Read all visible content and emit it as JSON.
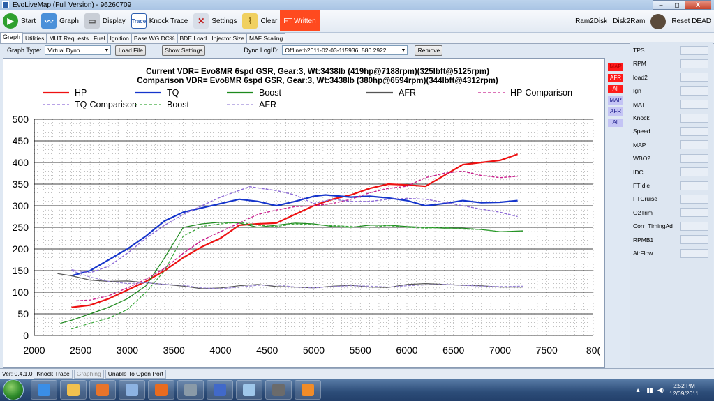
{
  "window": {
    "title": "EvoLiveMap (Full Version) - 96260709",
    "controls": [
      "–",
      "◻",
      "X"
    ]
  },
  "toolbar": {
    "start": "Start",
    "graph": "Graph",
    "display": "Display",
    "knock_trace": "Knock Trace",
    "settings": "Settings",
    "clear": "Clear",
    "ft_written": "FT Written",
    "ram2disk": "Ram2Disk",
    "disk2ram": "Disk2Ram",
    "reset_dead": "Reset DEAD"
  },
  "tabs": [
    "Graph",
    "Utilities",
    "MUT Requests",
    "Fuel",
    "Ignition",
    "Base WG DC%",
    "BDE Load",
    "Injector Size",
    "MAF Scaling"
  ],
  "options": {
    "graph_type_label": "Graph Type:",
    "graph_type_value": "Virtual Dyno",
    "load_file": "Load File",
    "show_settings": "Show Settings",
    "dyno_log_label": "Dyno LogID:",
    "dyno_log_value": "Offline:b2011-02-03-115936: 580.2922",
    "remove": "Remove"
  },
  "side_tags": [
    {
      "label": "MAP",
      "color": "#ff1a1a",
      "text": "#b00000"
    },
    {
      "label": "AFR",
      "color": "#ff1a1a",
      "text": "#ffffff"
    },
    {
      "label": "All",
      "color": "#ff1a1a",
      "text": "#ffffff"
    },
    {
      "label": "MAP",
      "color": "#c4c4f5",
      "text": "#1a1a8a"
    },
    {
      "label": "AFR",
      "color": "#c4c4f5",
      "text": "#1a1a8a"
    },
    {
      "label": "All",
      "color": "#c4c4f5",
      "text": "#1a1a8a"
    }
  ],
  "sensors": [
    "TPS",
    "RPM",
    "load2",
    "Ign",
    "MAT",
    "Knock",
    "Speed",
    "MAP",
    "WBO2",
    "IDC",
    "FTIdle",
    "FTCruise",
    "O2Trim",
    "Corr_TimingAd",
    "RPMB1",
    "AirFlow"
  ],
  "status": {
    "version": "Ver: 0.4.1.0",
    "knock_trace": "Knock Trace",
    "graphing": "Graphing",
    "port": "Unable To Open Port"
  },
  "clock": {
    "time": "2:52 PM",
    "date": "12/09/2011"
  },
  "taskbar_apps": [
    {
      "icon": "ie-icon",
      "color": "#3a8ee6"
    },
    {
      "icon": "folder-icon",
      "color": "#f2c14e"
    },
    {
      "icon": "media-player-icon",
      "color": "#e8742a"
    },
    {
      "icon": "paint-icon",
      "color": "#8db3e2"
    },
    {
      "icon": "firefox-icon",
      "color": "#e86b1f"
    },
    {
      "icon": "chip-icon",
      "color": "#8a9aa8"
    },
    {
      "icon": "vb-icon",
      "color": "#4169c9"
    },
    {
      "icon": "disc-icon",
      "color": "#9fc7ea"
    },
    {
      "icon": "car-icon",
      "color": "#6b6b6b"
    },
    {
      "icon": "tools-icon",
      "color": "#f28c28"
    }
  ],
  "chart_data": {
    "type": "line",
    "title": "Current VDR= Evo8MR 6spd GSR, Gear:3, Wt:3438lb (419hp@7188rpm)(325lbft@5125rpm)",
    "subtitle": "Comparison VDR= Evo8MR 6spd GSR, Gear:3, Wt:3438lb (380hp@6594rpm)(344lbft@4312rpm)",
    "xlim": [
      2000,
      8000
    ],
    "ylim": [
      0,
      500
    ],
    "xticks": [
      "2000",
      "2500",
      "3000",
      "3500",
      "4000",
      "4500",
      "5000",
      "5500",
      "6000",
      "6500",
      "7000",
      "7500",
      "80("
    ],
    "yticks": [
      "0",
      "50",
      "100",
      "150",
      "200",
      "250",
      "300",
      "350",
      "400",
      "450",
      "500"
    ],
    "grid": true,
    "legend_position": "top",
    "series": [
      {
        "name": "HP",
        "color": "#ee1111",
        "dash": false,
        "width": 2.2,
        "x": [
          2400,
          2600,
          2800,
          3000,
          3200,
          3400,
          3600,
          3800,
          4000,
          4200,
          4400,
          4600,
          4800,
          5000,
          5200,
          5400,
          5600,
          5800,
          6000,
          6200,
          6400,
          6600,
          6800,
          7000,
          7188
        ],
        "y": [
          65,
          70,
          85,
          105,
          125,
          150,
          180,
          205,
          225,
          255,
          258,
          260,
          280,
          300,
          315,
          325,
          340,
          350,
          348,
          345,
          370,
          395,
          400,
          405,
          419
        ]
      },
      {
        "name": "TQ",
        "color": "#1535cc",
        "dash": false,
        "width": 2.2,
        "x": [
          2400,
          2600,
          2800,
          3000,
          3200,
          3400,
          3600,
          3800,
          4000,
          4200,
          4400,
          4600,
          4800,
          5000,
          5125,
          5400,
          5600,
          5800,
          6000,
          6200,
          6400,
          6600,
          6800,
          7000,
          7188
        ],
        "y": [
          138,
          150,
          175,
          200,
          230,
          265,
          285,
          295,
          305,
          315,
          310,
          300,
          310,
          322,
          325,
          320,
          322,
          318,
          312,
          300,
          305,
          312,
          307,
          308,
          312
        ]
      },
      {
        "name": "Boost",
        "color": "#1d8a1d",
        "dash": false,
        "width": 1.2,
        "x": [
          2280,
          2400,
          2600,
          2800,
          3000,
          3200,
          3400,
          3600,
          3800,
          4000,
          4200,
          4400,
          4600,
          4800,
          5000,
          5200,
          5400,
          5600,
          5800,
          6000,
          6200,
          6400,
          6600,
          6800,
          7000,
          7250
        ],
        "y": [
          28,
          35,
          50,
          65,
          85,
          115,
          180,
          250,
          258,
          262,
          260,
          250,
          255,
          260,
          258,
          252,
          250,
          255,
          255,
          252,
          250,
          248,
          248,
          245,
          240,
          242
        ]
      },
      {
        "name": "AFR",
        "color": "#555555",
        "dash": false,
        "width": 1.2,
        "x": [
          2250,
          2400,
          2600,
          2800,
          3000,
          3200,
          3400,
          3600,
          3800,
          4000,
          4200,
          4400,
          4600,
          4800,
          5000,
          5200,
          5400,
          5600,
          5800,
          6000,
          6200,
          6400,
          6600,
          6800,
          7000,
          7250
        ],
        "y": [
          143,
          138,
          128,
          125,
          126,
          122,
          118,
          114,
          108,
          110,
          115,
          118,
          113,
          112,
          110,
          114,
          116,
          112,
          111,
          118,
          120,
          118,
          116,
          115,
          112,
          112
        ]
      },
      {
        "name": "HP-Comparison",
        "color": "#c81f8c",
        "dash": true,
        "width": 1.4,
        "x": [
          2450,
          2600,
          2800,
          3000,
          3200,
          3400,
          3600,
          3800,
          4000,
          4200,
          4400,
          4600,
          4800,
          5000,
          5200,
          5400,
          5600,
          5800,
          6000,
          6200,
          6400,
          6594,
          6800,
          7000,
          7188
        ],
        "y": [
          80,
          82,
          92,
          110,
          130,
          155,
          190,
          220,
          240,
          260,
          280,
          290,
          298,
          300,
          305,
          315,
          330,
          340,
          345,
          365,
          375,
          380,
          370,
          365,
          368
        ]
      },
      {
        "name": "TQ-Comparison",
        "color": "#8d6ad6",
        "dash": true,
        "width": 1.4,
        "x": [
          2400,
          2600,
          2800,
          3000,
          3200,
          3400,
          3600,
          3800,
          4000,
          4312,
          4600,
          4800,
          5000,
          5200,
          5400,
          5600,
          5800,
          6000,
          6200,
          6400,
          6600,
          6800,
          7000,
          7188
        ],
        "y": [
          152,
          145,
          160,
          190,
          225,
          255,
          280,
          300,
          320,
          344,
          335,
          325,
          305,
          315,
          310,
          310,
          315,
          317,
          315,
          308,
          300,
          292,
          285,
          275
        ]
      },
      {
        "name": "Boost",
        "color": "#3aa83a",
        "dash": true,
        "width": 1.2,
        "x": [
          2400,
          2600,
          2800,
          3000,
          3200,
          3400,
          3600,
          3800,
          4000,
          4200,
          4400,
          4600,
          4800,
          5000,
          5200,
          5400,
          5600,
          5800,
          6000,
          6200,
          6400,
          6600,
          6800,
          7000,
          7250
        ],
        "y": [
          15,
          28,
          40,
          60,
          100,
          150,
          230,
          252,
          258,
          262,
          255,
          252,
          258,
          256,
          254,
          252,
          250,
          254,
          250,
          248,
          250,
          246,
          245,
          240,
          240
        ]
      },
      {
        "name": "AFR",
        "color": "#9a86d6",
        "dash": true,
        "width": 1.2,
        "x": [
          2400,
          2600,
          2800,
          3000,
          3200,
          3400,
          3600,
          3800,
          4000,
          4200,
          4400,
          4600,
          4800,
          5000,
          5200,
          5400,
          5600,
          5800,
          6000,
          6200,
          6400,
          6600,
          6800,
          7000,
          7250
        ],
        "y": [
          150,
          135,
          125,
          120,
          122,
          118,
          116,
          110,
          108,
          112,
          116,
          117,
          112,
          110,
          113,
          115,
          114,
          112,
          115,
          117,
          118,
          116,
          114,
          113,
          114
        ]
      }
    ]
  }
}
